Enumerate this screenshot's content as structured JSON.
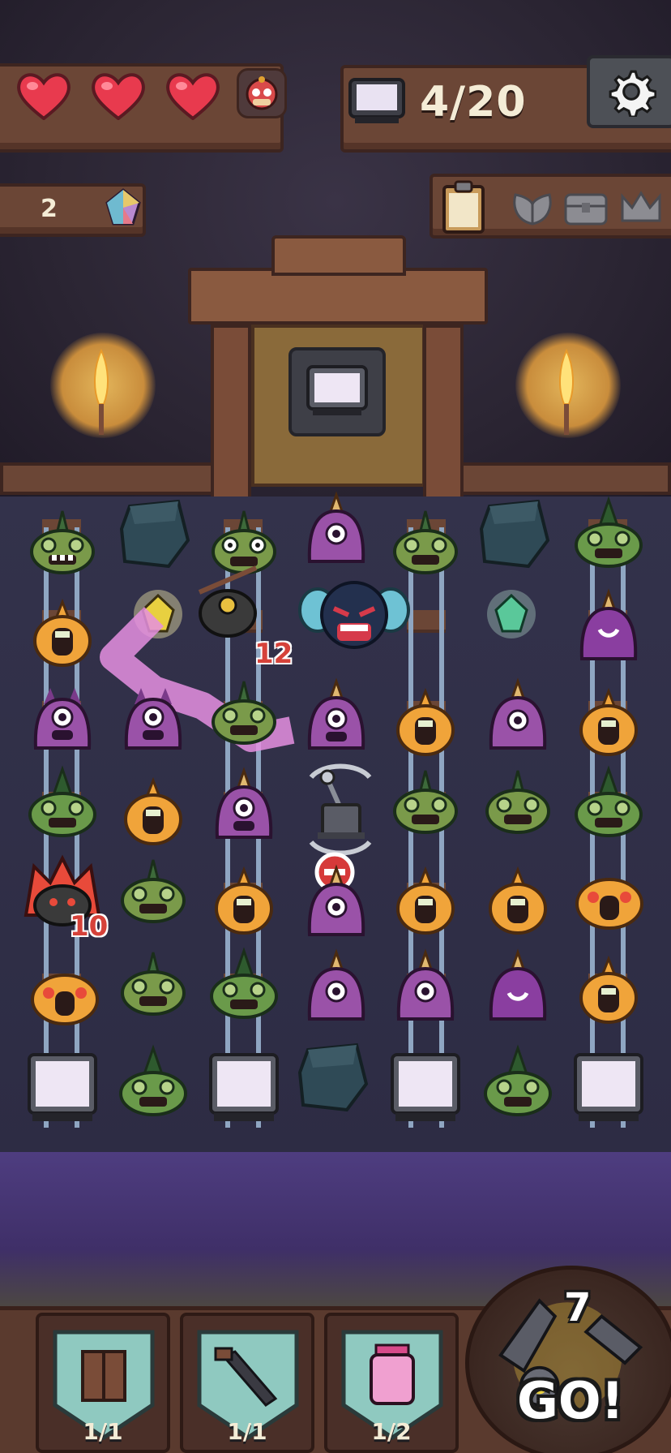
{
  "hud": {
    "lives": 3,
    "carts_progress": "4/20",
    "gems": "2"
  },
  "icons": {
    "heart": "heart-icon",
    "portrait": "player-portrait",
    "cart": "mine-cart-icon",
    "settings": "gear-icon",
    "gem": "crystal-gem-icon",
    "clipboard": "clipboard-icon",
    "goals": [
      "leaf-goal-icon",
      "chest-goal-icon",
      "crown-goal-icon"
    ]
  },
  "board": {
    "damage_labels": [
      "12",
      "10"
    ]
  },
  "tools": [
    {
      "name": "wood-planks",
      "count": "1/1"
    },
    {
      "name": "dagger",
      "count": "1/1"
    },
    {
      "name": "potion-jar",
      "count": "1/2"
    }
  ],
  "go_button": {
    "moves": "7",
    "label": "GO!"
  },
  "colors": {
    "heart": "#e83a4e",
    "green_monster": "#7a9a4a",
    "orange_monster": "#f0a43a",
    "purple_monster": "#9a52a8",
    "arrow": "#e58fe0"
  }
}
